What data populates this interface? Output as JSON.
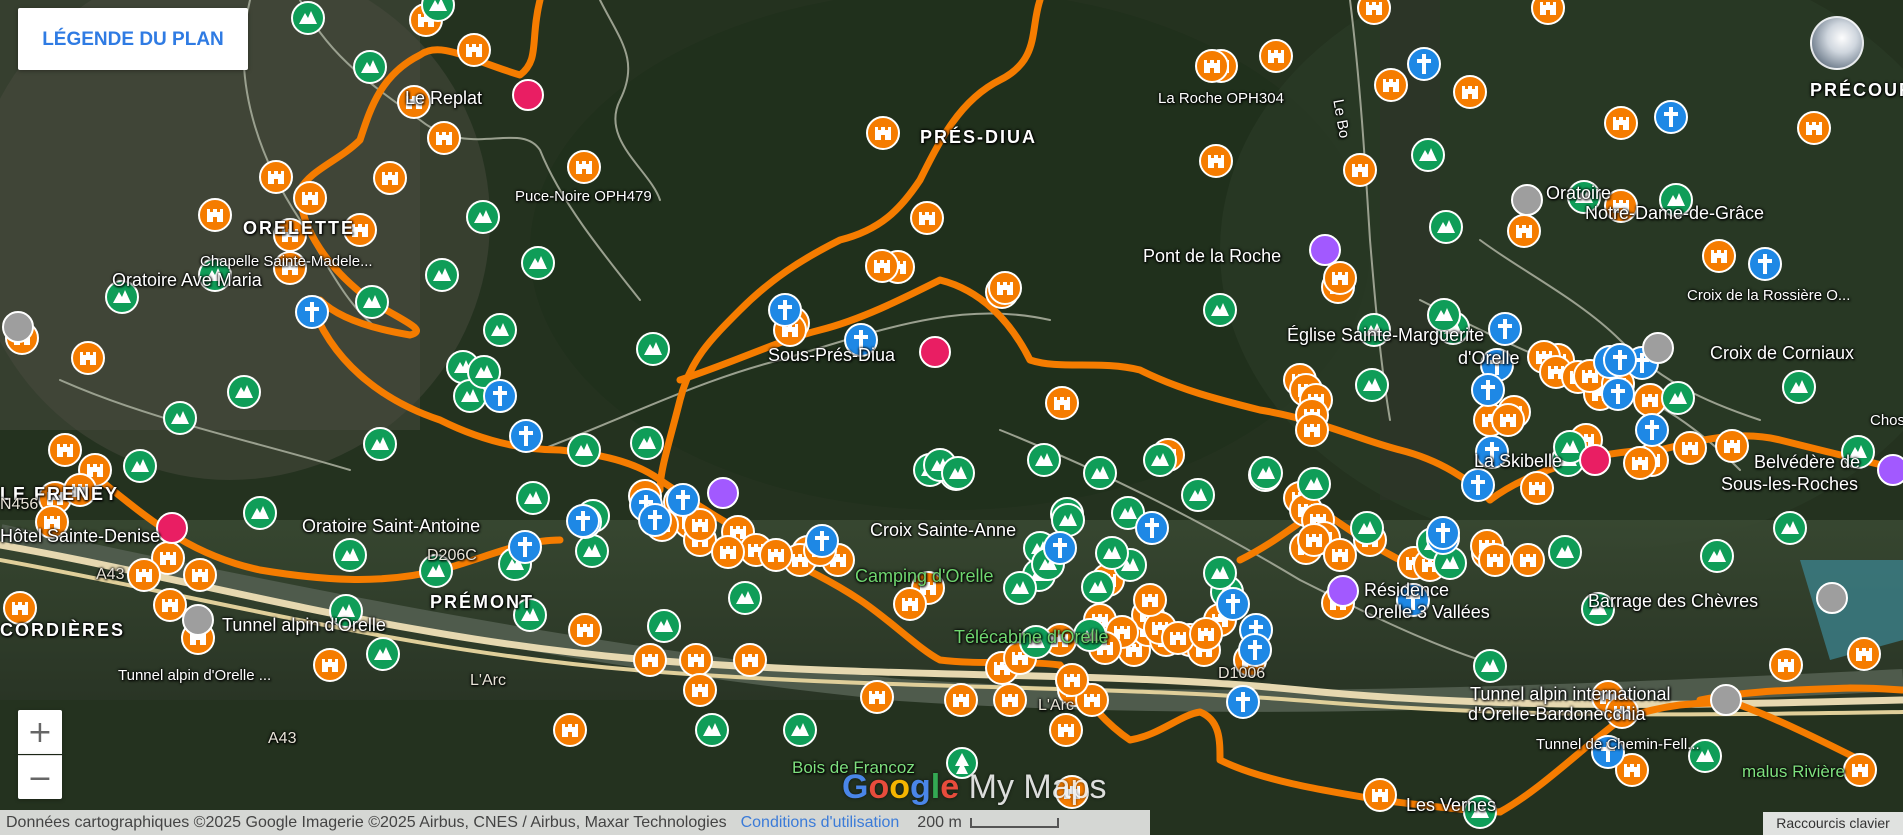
{
  "legend_button": "LÉGENDE DU PLAN",
  "zoom": {
    "in": "+",
    "out": "−"
  },
  "attribution": {
    "data": "Données cartographiques ©2025 Google Imagerie ©2025 Airbus, CNES / Airbus, Maxar Technologies",
    "terms": "Conditions d'utilisation",
    "scale": "200 m",
    "shortcuts": "Raccourcis clavier"
  },
  "brand": {
    "google": "Google",
    "mymaps": "My Maps"
  },
  "colors": {
    "route": "#f57c00",
    "castle_marker": "#f57c00",
    "mountain_marker": "#0f9d58",
    "cross_marker": "#1e88e5",
    "hotel_marker": "#e91e63",
    "camera_marker": "#a259ff",
    "monument_marker": "#9e9e9e"
  },
  "place_labels": [
    {
      "id": "replat",
      "text": "Le Replat",
      "style": "normal"
    },
    {
      "id": "puce-noire",
      "text": "Puce-Noire OPH479",
      "style": "small"
    },
    {
      "id": "orelette",
      "text": "ORELETTE",
      "style": "caps"
    },
    {
      "id": "chapelle",
      "text": "Chapelle Sainte-Madele...",
      "style": "small"
    },
    {
      "id": "oratoire-maria",
      "text": "Oratoire Ave Maria",
      "style": "normal"
    },
    {
      "id": "pres-diua",
      "text": "PRÉS-DIUA",
      "style": "caps"
    },
    {
      "id": "la-roche",
      "text": "La Roche OPH304",
      "style": "small"
    },
    {
      "id": "sous-pres",
      "text": "Sous-Prés-Diua",
      "style": "normal"
    },
    {
      "id": "pont-roche",
      "text": "Pont de la Roche",
      "style": "normal"
    },
    {
      "id": "eglise",
      "text": "Église Sainte-Marguerite",
      "style": "normal"
    },
    {
      "id": "eglise2",
      "text": "d'Orelle",
      "style": "normal"
    },
    {
      "id": "oratoire-grace",
      "text": "Oratoire",
      "style": "normal"
    },
    {
      "id": "oratoire-grace2",
      "text": "Notre-Dame-de-Grâce",
      "style": "normal"
    },
    {
      "id": "croix-rossiere",
      "text": "Croix de la Rossière O...",
      "style": "small"
    },
    {
      "id": "croix-corniaux",
      "text": "Croix de Corniaux",
      "style": "normal"
    },
    {
      "id": "precour",
      "text": "PRÉCOUR",
      "style": "caps"
    },
    {
      "id": "la-skibelle",
      "text": "La Skibelle",
      "style": "normal"
    },
    {
      "id": "belvedere",
      "text": "Belvédère de",
      "style": "normal"
    },
    {
      "id": "belvedere2",
      "text": "Sous-les-Roches",
      "style": "normal"
    },
    {
      "id": "oratoire-antoine",
      "text": "Oratoire Saint-Antoine",
      "style": "normal"
    },
    {
      "id": "hotel-denise",
      "text": "Hôtel Sainte-Denise",
      "style": "normal"
    },
    {
      "id": "le-freney",
      "text": "LE FRENEY",
      "style": "caps"
    },
    {
      "id": "premont",
      "text": "PRÉMONT",
      "style": "caps"
    },
    {
      "id": "cordieres",
      "text": "CORDIÈRES",
      "style": "caps"
    },
    {
      "id": "tunnel-orelle",
      "text": "Tunnel alpin d'Orelle",
      "style": "normal"
    },
    {
      "id": "tunnel-orelle2",
      "text": "Tunnel alpin d'Orelle ...",
      "style": "small"
    },
    {
      "id": "croix-anne",
      "text": "Croix Sainte-Anne",
      "style": "normal"
    },
    {
      "id": "camping",
      "text": "Camping d'Orelle",
      "style": "green"
    },
    {
      "id": "telecabine",
      "text": "Télécabine d'Orelle",
      "style": "green"
    },
    {
      "id": "residence",
      "text": "Résidence",
      "style": "normal"
    },
    {
      "id": "residence2",
      "text": "Orelle 3 Vallées",
      "style": "normal"
    },
    {
      "id": "barrage",
      "text": "Barrage des Chèvres",
      "style": "normal"
    },
    {
      "id": "tunnel-intl",
      "text": "Tunnel alpin international",
      "style": "normal"
    },
    {
      "id": "tunnel-intl2",
      "text": "d'Orelle-Bardonecchia",
      "style": "normal"
    },
    {
      "id": "tunnel-chemin",
      "text": "Tunnel de Chemin-Fell...",
      "style": "small"
    },
    {
      "id": "bois-francoz",
      "text": "Bois de Francoz",
      "style": "green2"
    },
    {
      "id": "les-vernes",
      "text": "Les Vernes",
      "style": "normal"
    },
    {
      "id": "malus",
      "text": "malus Rivière",
      "style": "green2"
    },
    {
      "id": "le-bo",
      "text": "Le Bo",
      "style": "small"
    },
    {
      "id": "larc1",
      "text": "L'Arc",
      "style": "road"
    },
    {
      "id": "larc2",
      "text": "L'Arc",
      "style": "road"
    },
    {
      "id": "d1006",
      "text": "D1006",
      "style": "road"
    },
    {
      "id": "a43a",
      "text": "A43",
      "style": "road"
    },
    {
      "id": "a43b",
      "text": "A43",
      "style": "road"
    },
    {
      "id": "n456",
      "text": "N456",
      "style": "road"
    },
    {
      "id": "d206c",
      "text": "D206C",
      "style": "road"
    },
    {
      "id": "chos",
      "text": "Chos",
      "style": "small"
    }
  ],
  "marker_counts": {
    "castle": 170,
    "mountain": 80,
    "cross": 30
  }
}
